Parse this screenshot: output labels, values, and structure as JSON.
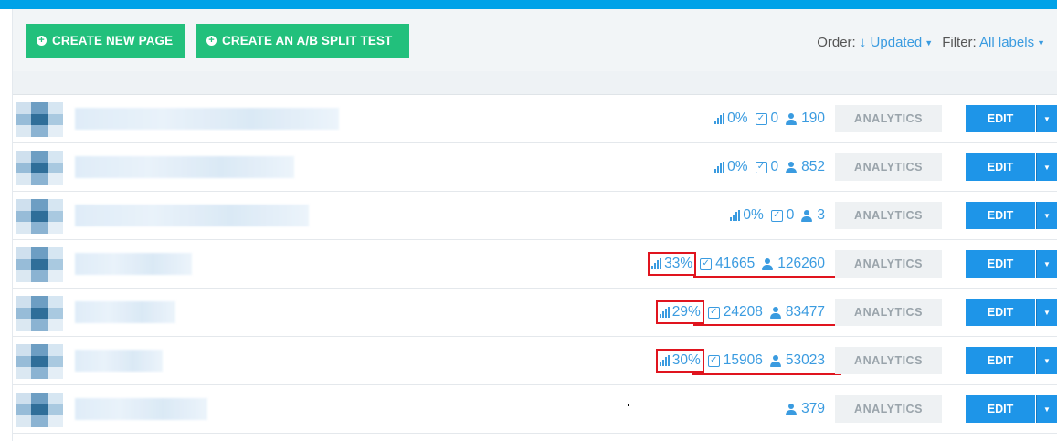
{
  "toolbar": {
    "create_page_label": "CREATE NEW PAGE",
    "create_ab_label": "CREATE AN A/B SPLIT TEST",
    "order_label": "Order:",
    "order_value": "↓ Updated",
    "filter_label": "Filter:",
    "filter_value": "All labels"
  },
  "row_buttons": {
    "analytics_label": "ANALYTICS",
    "edit_label": "EDIT"
  },
  "pages": [
    {
      "conversion": "0%",
      "conversions": "0",
      "visitors": "190"
    },
    {
      "conversion": "0%",
      "conversions": "0",
      "visitors": "852"
    },
    {
      "conversion": "0%",
      "conversions": "0",
      "visitors": "3"
    },
    {
      "conversion": "33%",
      "conversions": "41665",
      "visitors": "126260"
    },
    {
      "conversion": "29%",
      "conversions": "24208",
      "visitors": "83477"
    },
    {
      "conversion": "30%",
      "conversions": "15906",
      "visitors": "53023"
    },
    {
      "conversion": "",
      "conversions": "",
      "visitors": "379"
    }
  ],
  "icons": {
    "plus": "plus-circle-icon",
    "bars": "bar-chart-icon",
    "check": "check-square-icon",
    "user": "user-icon",
    "caret": "caret-down-icon"
  },
  "colors": {
    "accent_blue": "#1e95e8",
    "green": "#22c07c",
    "link": "#3a9be0",
    "annotation_red": "#e0141e"
  }
}
